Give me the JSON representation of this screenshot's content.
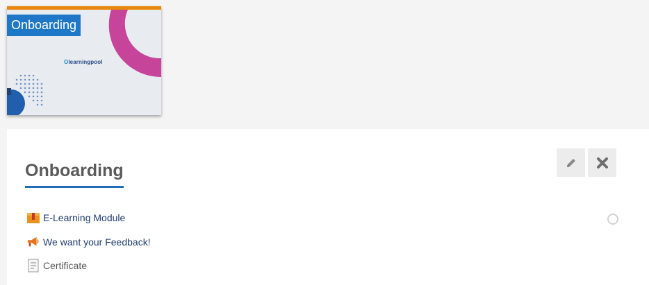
{
  "course_image": {
    "title": "Onboarding",
    "logo_text": "learningpool",
    "logo_mark": "O"
  },
  "panel": {
    "title": "Onboarding",
    "edit_icon": "pencil-icon",
    "close_icon": "close-icon",
    "items": [
      {
        "label": "E-Learning Module",
        "icon": "package-icon"
      },
      {
        "label": "We want your Feedback!",
        "icon": "megaphone-icon"
      },
      {
        "label": "Certificate",
        "icon": "document-icon"
      }
    ]
  },
  "colors": {
    "accent_blue": "#1f77c8",
    "top_bar_orange": "#e8880e",
    "arc_magenta": "#c6459a"
  }
}
